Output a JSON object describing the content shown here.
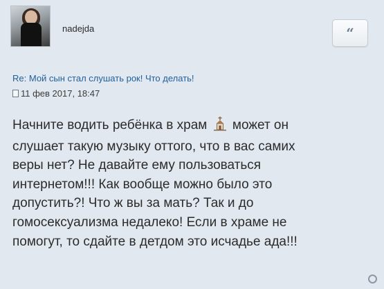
{
  "post": {
    "username": "nadejda",
    "quote_label": "“",
    "subject": "Re: Мой сын стал слушать рок! Что делать!",
    "date": "11 фев 2017, 18:47",
    "body_before_icon": "Начните водить ребёнка в храм",
    "body_after_icon": "может он\nслушает такую музыку оттого, что в вас самих\nверы нет? Не давайте ему пользоваться\nинтернетом!!! Как вообще можно было это\nдопустить?! Что ж вы за мать? Так и до\nгомосексуализма недалеко! Если в храме не\nпомогут, то сдайте в детдом это исчадье ада!!!",
    "inline_icon": "church-icon",
    "meta_icon": "post-file-icon"
  },
  "colors": {
    "background": "#e2e8f0",
    "subject_link": "#1f5f9a",
    "text": "#2b2b2b"
  }
}
